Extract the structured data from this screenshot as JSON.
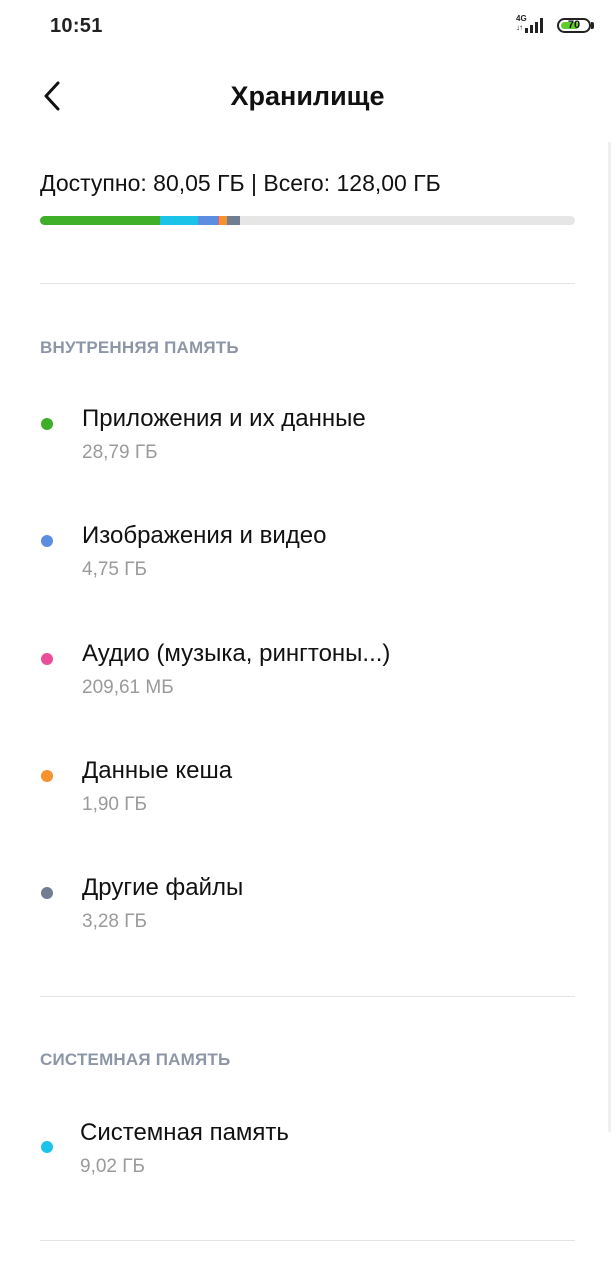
{
  "status_bar": {
    "time": "10:51",
    "network": "4G",
    "battery_level": "70",
    "battery_fraction": 0.7,
    "signal_icon": "signal-bars-icon",
    "battery_color": "#5fcc2a"
  },
  "header": {
    "title": "Хранилище",
    "back_icon": "chevron-left-icon"
  },
  "summary": {
    "text": "Доступно: 80,05 ГБ | Всего: 128,00 ГБ"
  },
  "usage_bar": {
    "total_gb": 128,
    "segments": [
      {
        "name": "apps",
        "value_gb": 28.79,
        "color": "#3fae29"
      },
      {
        "name": "system",
        "value_gb": 9.02,
        "color": "#1bc3e8"
      },
      {
        "name": "images_video",
        "value_gb": 4.75,
        "color": "#5b8ee0"
      },
      {
        "name": "audio",
        "value_gb": 0.21,
        "color": "#ec4f9a"
      },
      {
        "name": "cache",
        "value_gb": 1.9,
        "color": "#f5922f"
      },
      {
        "name": "other",
        "value_gb": 3.28,
        "color": "#717d91"
      }
    ]
  },
  "internal": {
    "header": "ВНУТРЕННЯЯ ПАМЯТЬ",
    "items": [
      {
        "label": "Приложения и их данные",
        "size": "28,79 ГБ",
        "color": "#3fae29"
      },
      {
        "label": "Изображения и видео",
        "size": "4,75 ГБ",
        "color": "#5b8ee0"
      },
      {
        "label": "Аудио (музыка, рингтоны...)",
        "size": "209,61 МБ",
        "color": "#ec4f9a"
      },
      {
        "label": "Данные кеша",
        "size": "1,90 ГБ",
        "color": "#f5922f"
      },
      {
        "label": "Другие файлы",
        "size": "3,28 ГБ",
        "color": "#717d91"
      }
    ]
  },
  "system": {
    "header": "СИСТЕМНАЯ ПАМЯТЬ",
    "items": [
      {
        "label": "Системная память",
        "size": "9,02 ГБ",
        "color": "#1bc3e8"
      }
    ]
  }
}
